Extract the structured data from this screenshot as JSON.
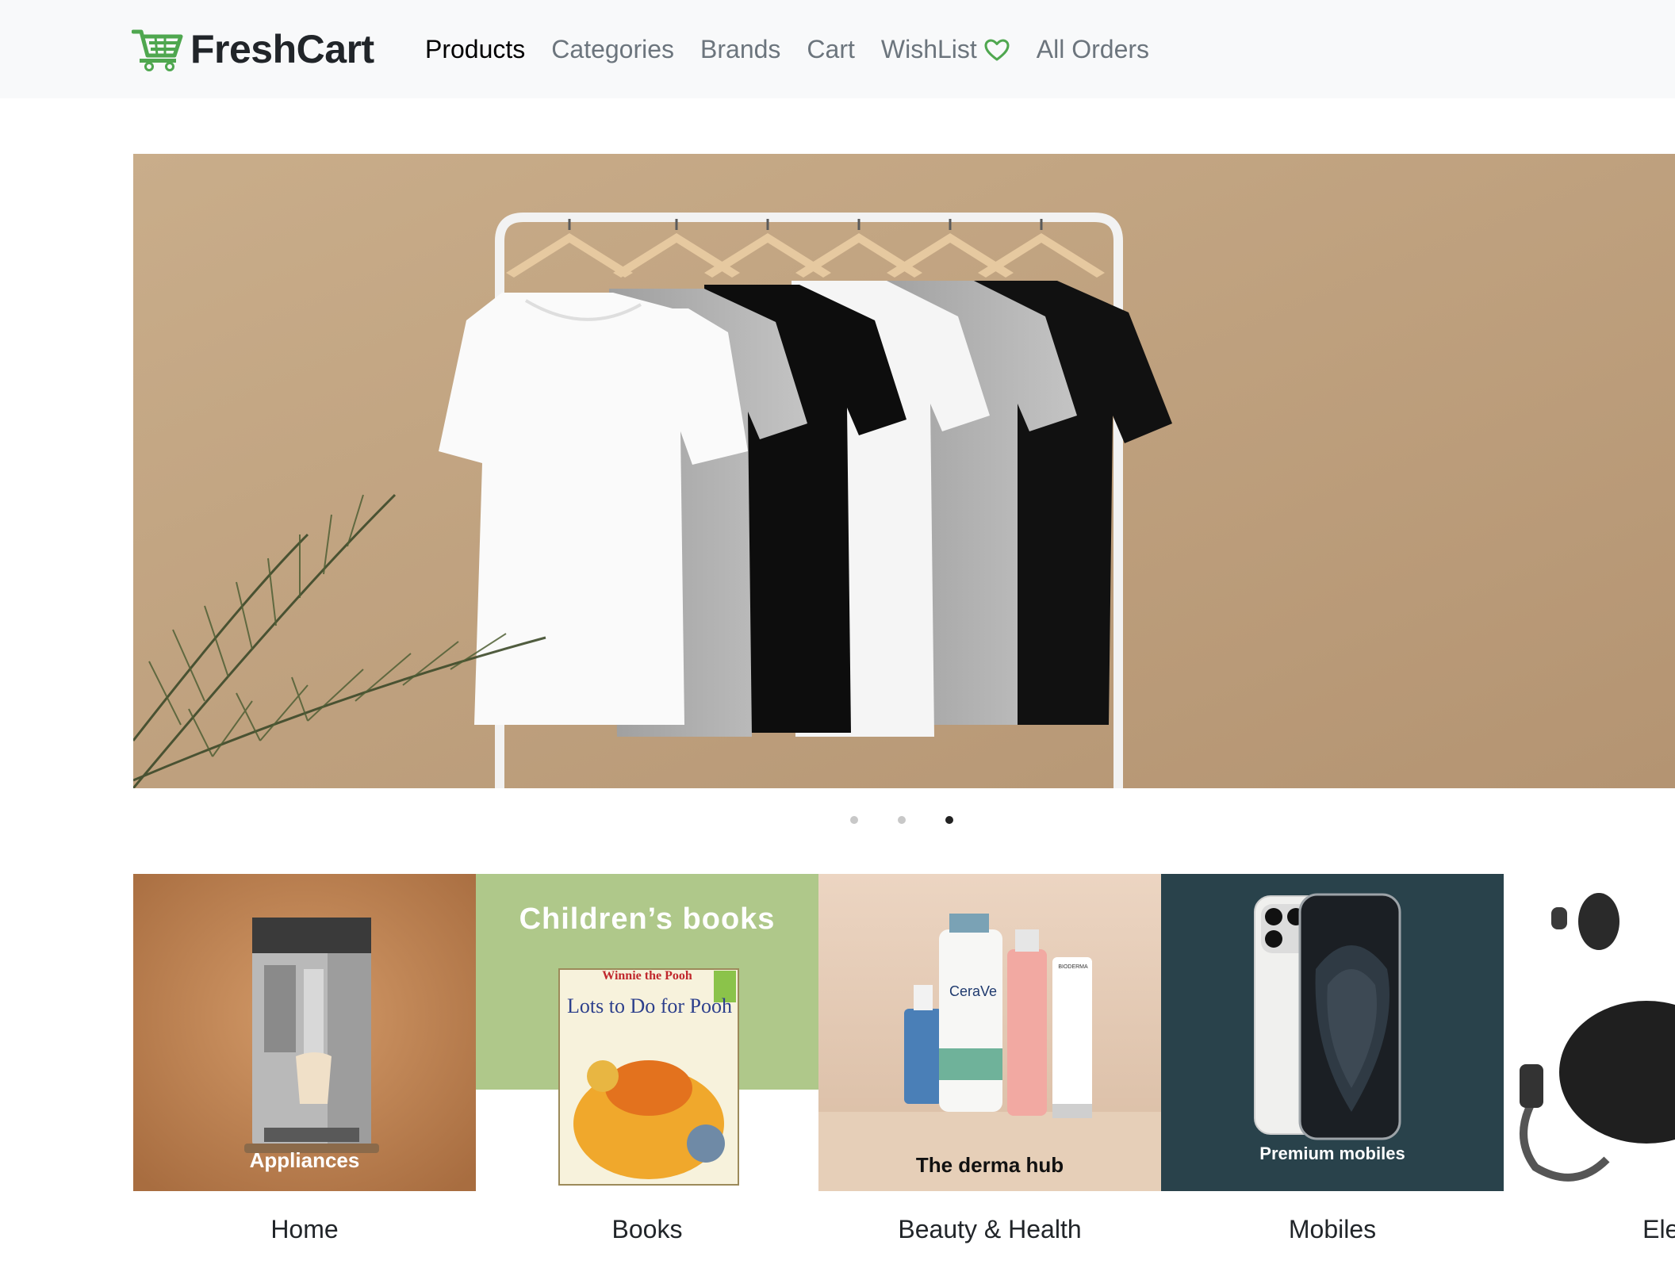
{
  "app": {
    "brand": "FreshCart"
  },
  "nav": {
    "items": [
      {
        "label": "Products",
        "active": true
      },
      {
        "label": "Categories"
      },
      {
        "label": "Brands"
      },
      {
        "label": "Cart"
      },
      {
        "label": "WishList",
        "icon": "heart-icon"
      },
      {
        "label": "All Orders"
      }
    ]
  },
  "hero": {
    "slide_count": 3,
    "active_slide": 3
  },
  "categories": [
    {
      "name": "Home",
      "banner_text": "Appliances"
    },
    {
      "name": "Books",
      "banner_text": "Children’s books",
      "book_title": "Lots to Do for Pooh",
      "book_brand": "Winnie the Pooh"
    },
    {
      "name": "Beauty & Health",
      "banner_text": "The derma hub",
      "product_brand": "CeraVe",
      "product_brand_2": "BIODERMA"
    },
    {
      "name": "Mobiles",
      "banner_text": "Premium mobiles"
    },
    {
      "name": "Electr"
    }
  ],
  "colors": {
    "brand_green": "#4fa74f",
    "nav_bg": "#f8f9fa",
    "text_dark": "#212529",
    "text_muted": "#6c757d"
  }
}
